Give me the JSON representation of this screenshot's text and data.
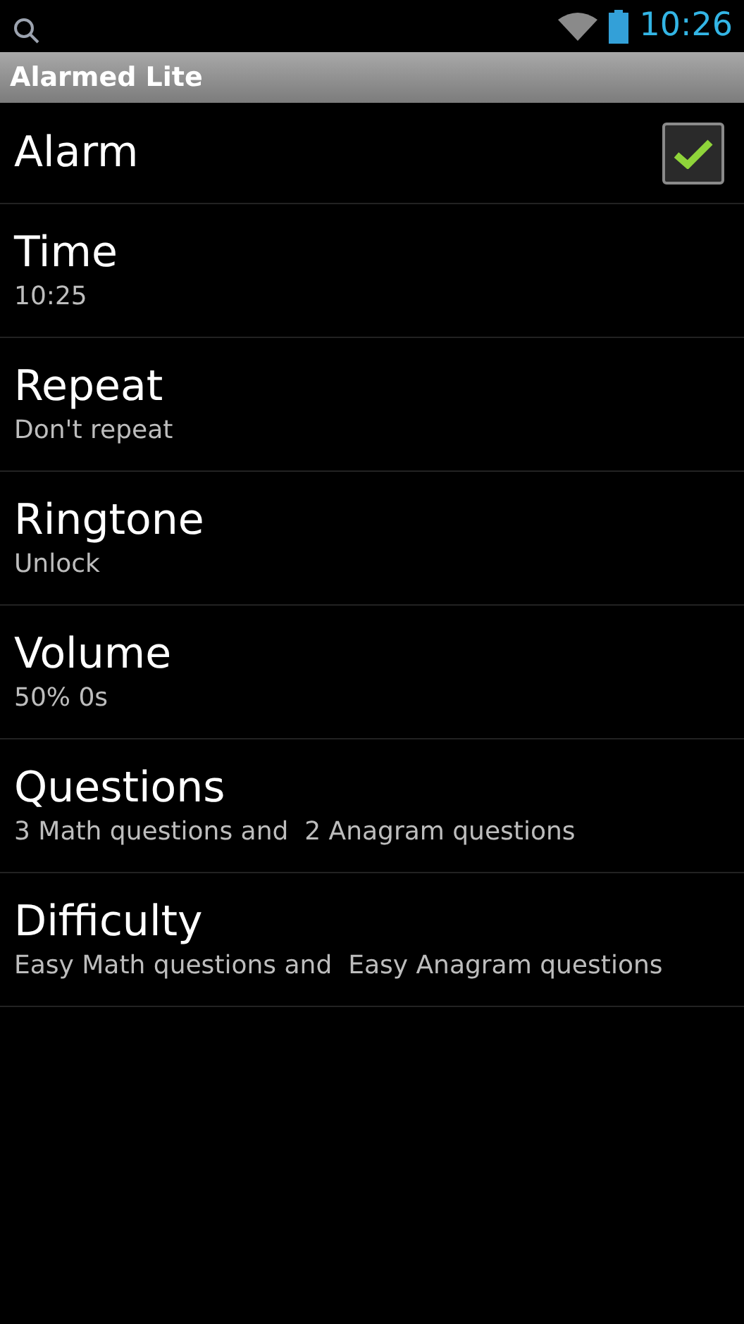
{
  "status_bar": {
    "time": "10:26"
  },
  "title_bar": {
    "title": "Alarmed Lite"
  },
  "settings": [
    {
      "kind": "checkbox",
      "title": "Alarm",
      "checked": true
    },
    {
      "kind": "summary",
      "title": "Time",
      "summary": "10:25"
    },
    {
      "kind": "summary",
      "title": "Repeat",
      "summary": "Don't repeat"
    },
    {
      "kind": "summary",
      "title": "Ringtone",
      "summary": "Unlock"
    },
    {
      "kind": "summary",
      "title": "Volume",
      "summary": "50% 0s"
    },
    {
      "kind": "summary",
      "title": "Questions",
      "summary": "3 Math questions and  2 Anagram questions"
    },
    {
      "kind": "summary",
      "title": "Difficulty",
      "summary": "Easy Math questions and  Easy Anagram questions"
    }
  ]
}
